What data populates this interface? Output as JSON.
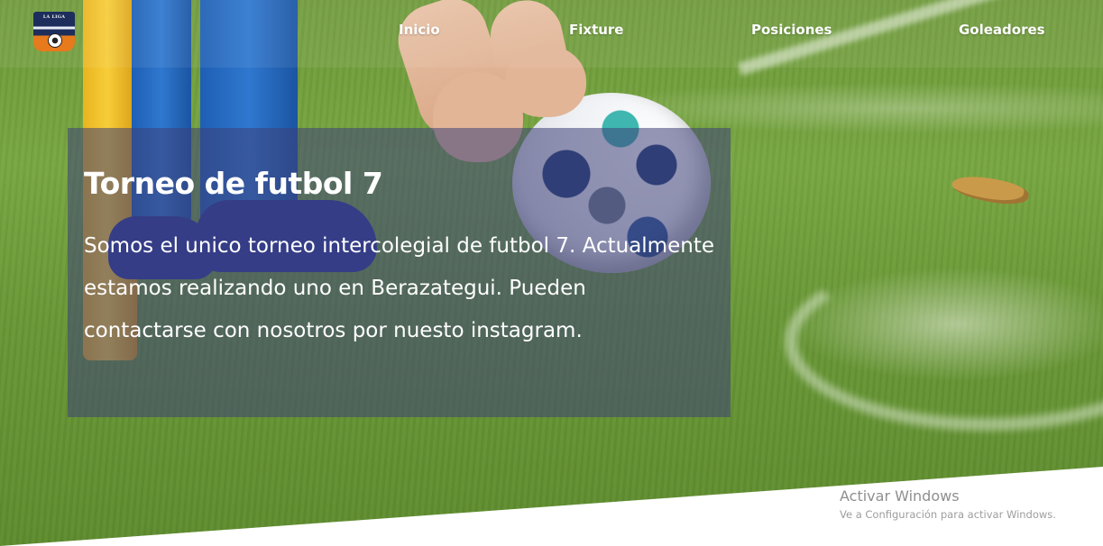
{
  "brand": {
    "logo_text": "LA LIGA"
  },
  "nav": {
    "items": [
      {
        "label": "Inicio"
      },
      {
        "label": "Fixture"
      },
      {
        "label": "Posiciones"
      },
      {
        "label": "Goleadores"
      }
    ]
  },
  "hero": {
    "title": "Torneo de futbol 7",
    "description": "Somos el unico torneo intercolegial de futbol 7. Actualmente estamos realizando uno en Berazategui. Pueden contactarse con nosotros por nuesto instagram.",
    "ball_brand_icon": "soccer-ball-image"
  },
  "watermark": {
    "title": "Activar Windows",
    "subtitle": "Ve a Configuración para activar Windows."
  },
  "colors": {
    "card_overlay": "#3e4078",
    "nav_text": "#ffffff",
    "grass": "#6f9a3a",
    "flag_yellow": "#f7cd3a",
    "watermark_text": "#8f8f8f"
  }
}
